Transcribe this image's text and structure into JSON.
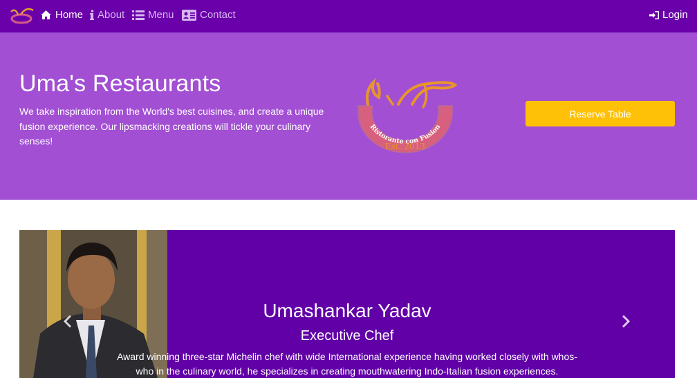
{
  "navbar": {
    "brand_icon": "restaurant-logo-icon",
    "items": [
      {
        "label": "Home",
        "icon": "home-icon",
        "active": true
      },
      {
        "label": "About",
        "icon": "info-icon",
        "active": false
      },
      {
        "label": "Menu",
        "icon": "list-icon",
        "active": false
      },
      {
        "label": "Contact",
        "icon": "address-card-icon",
        "active": false
      }
    ],
    "login": {
      "label": "Login",
      "icon": "sign-in-icon"
    }
  },
  "jumbotron": {
    "title": "Uma's Restaurants",
    "description": "We take inspiration from the World's best cuisines, and create a unique fusion experience. Our lipsmacking creations will tickle your culinary senses!",
    "logo_text": "Ristorante con Fusion",
    "logo_year": "Est. 2013",
    "reserve_label": "Reserve Table"
  },
  "carousel": {
    "name": "Umashankar Yadav",
    "designation": "Executive Chef",
    "description": "Award winning three-star Michelin chef with wide International experience having worked closely with whos-who in the culinary world, he specializes in creating mouthwatering Indo-Italian fusion experiences.",
    "prev_icon": "chevron-left-icon",
    "next_icon": "chevron-right-icon"
  },
  "colors": {
    "navbar_bg": "#6a00aa",
    "jumbotron_bg": "#a24fd3",
    "carousel_bg": "#6200a8",
    "reserve_button": "#ffc107"
  }
}
